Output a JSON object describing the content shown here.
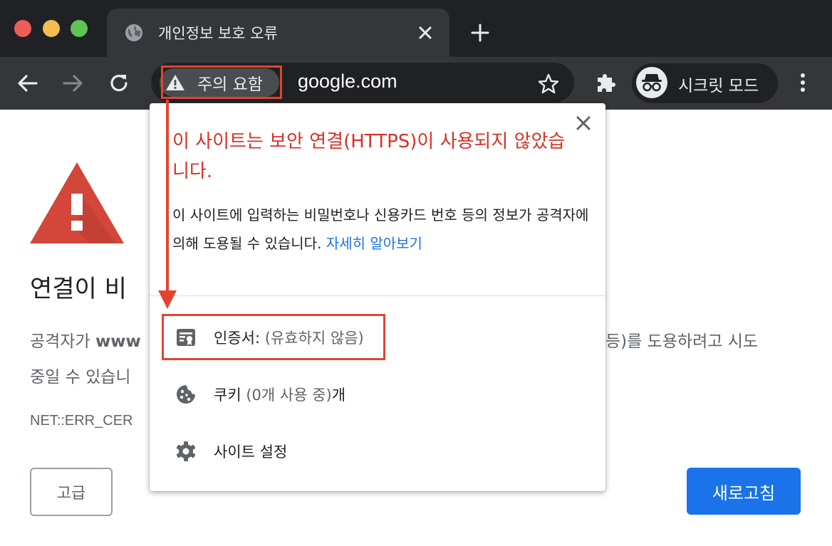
{
  "window": {
    "tab": {
      "title": "개인정보 보호 오류",
      "favicon": "globe-icon"
    }
  },
  "toolbar": {
    "site_chip_label": "주의 요함",
    "url": "google.com",
    "incognito_label": "시크릿 모드"
  },
  "page": {
    "heading": "연결이 비",
    "body_line1_start": "공격자가 ",
    "body_line1_bold": "www",
    "body_line1_end": " 등)를 도용하려고 시도",
    "body_line2": "중일 수 있습니",
    "error_code": "NET::ERR_CER",
    "advanced_button": "고급",
    "reload_button": "새로고침"
  },
  "popup": {
    "title": "이 사이트는 보안 연결(HTTPS)이 사용되지 않았습니다.",
    "description": "이 사이트에 입력하는 비밀번호나 신용카드 번호 등의 정보가 공격자에 의해 도용될 수 있습니다.",
    "learn_more": "자세히 알아보기",
    "certificate_label": "인증서:",
    "certificate_status": "(유효하지 않음)",
    "cookies_label": "쿠키",
    "cookies_status": "(0개 사용 중)",
    "cookies_suffix": "개",
    "site_settings_label": "사이트 설정"
  },
  "colors": {
    "warning_red": "#d93025",
    "annotation_red": "#e2442f",
    "link_blue": "#1a73e8",
    "chrome_dark": "#202124",
    "toolbar_dark": "#35363a"
  }
}
